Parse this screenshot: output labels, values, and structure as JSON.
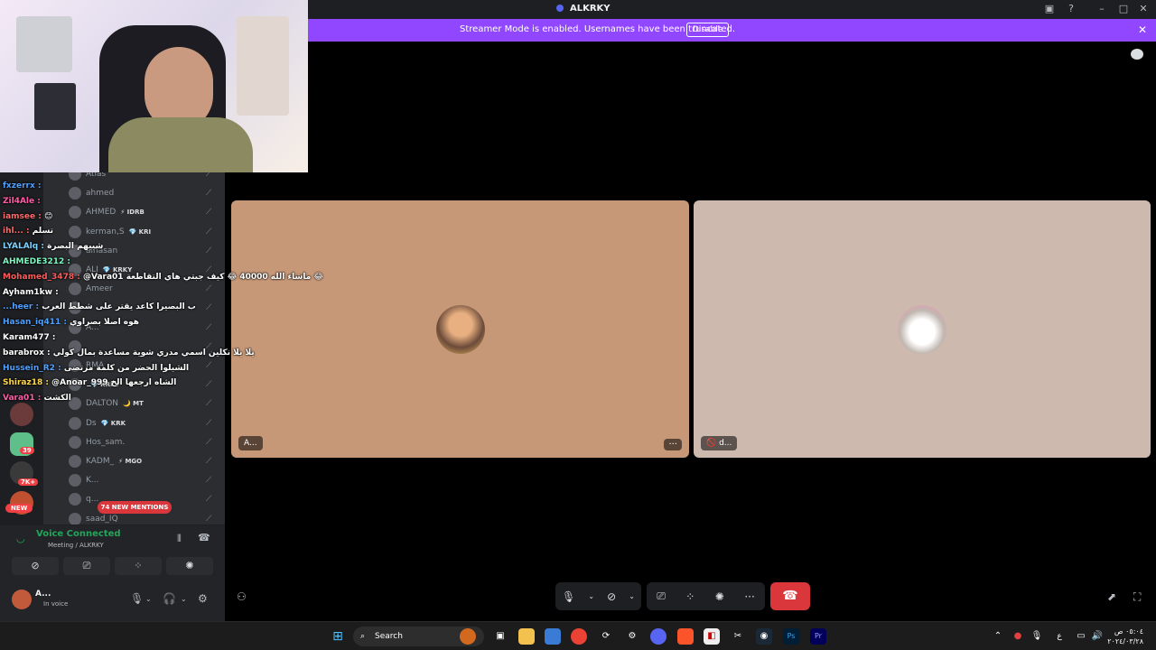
{
  "window": {
    "title": "ALKRKY"
  },
  "banner": {
    "text": "Streamer Mode is enabled. Usernames have been truncated.",
    "disable_label": "Disable"
  },
  "members": [
    {
      "name": "Atlas",
      "tag": ""
    },
    {
      "name": "ahmed",
      "tag": ""
    },
    {
      "name": "AHMED",
      "tag": "⚡ IDRB"
    },
    {
      "name": "kerman,S",
      "tag": "💎 KRI"
    },
    {
      "name": "alhasan",
      "tag": ""
    },
    {
      "name": "ALI",
      "tag": "💎 KRKY"
    },
    {
      "name": "Ameer",
      "tag": ""
    },
    {
      "name": "",
      "tag": ""
    },
    {
      "name": "A...",
      "tag": ""
    },
    {
      "name": "",
      "tag": ""
    },
    {
      "name": "RMA",
      "tag": ""
    },
    {
      "name": "",
      "tag": "💎 KRKY"
    },
    {
      "name": "DALTON",
      "tag": "🌙 MT"
    },
    {
      "name": "Ds",
      "tag": "💎 KRK"
    },
    {
      "name": "Hos_sam.",
      "tag": ""
    },
    {
      "name": "KADM_",
      "tag": "⚡ MGO"
    },
    {
      "name": "K...",
      "tag": ""
    },
    {
      "name": "q...",
      "tag": ""
    },
    {
      "name": "saad_IQ",
      "tag": ""
    }
  ],
  "chat": [
    {
      "user": "fxzerrx :",
      "msg": "",
      "color": "#4fa0ff"
    },
    {
      "user": "Zil4Ale :",
      "msg": "",
      "color": "#ff5ca8"
    },
    {
      "user": "iamsee :",
      "msg": "😊",
      "color": "#ff6b6b"
    },
    {
      "user": "ihl... :",
      "msg": "تسلم",
      "color": "#ff6b6b"
    },
    {
      "user": "LYALAlq :",
      "msg": "شبيهم البصرة",
      "color": "#7dd3fc"
    },
    {
      "user": "AHMEDE3212 :",
      "msg": "",
      "color": "#7cf7c0"
    },
    {
      "user": "Mohamed_3478 :",
      "msg": "@Vara01 ماشاء الله 40000 😂 كيف جبتي هاي التقاطعة 😂",
      "color": "#ff5c5c"
    },
    {
      "user": "Ayham1kw :",
      "msg": "",
      "color": "#ffffff"
    },
    {
      "user": "...heer :",
      "msg": "ب البصيرا كاعد يقتر على شطط العرب",
      "color": "#4fa0ff"
    },
    {
      "user": "Hasan_iq411 :",
      "msg": "هوه اصلا بصراوي",
      "color": "#4fa0ff"
    },
    {
      "user": "Karam477 :",
      "msg": "",
      "color": "#ffffff"
    },
    {
      "user": "barabrox :",
      "msg": "يلا يلا تكلين اسمي مدري شوية مساعدة بمال كولي",
      "color": "#ffffff"
    },
    {
      "user": "Hussein_R2 :",
      "msg": "الشيلوا الحضر من كلمة مرتضى",
      "color": "#4fa0ff"
    },
    {
      "user": "Shiraz18 :",
      "msg": "@Anoar_999 الشاه ارجعها الخ",
      "color": "#ffd84d"
    },
    {
      "user": "Vara01 :",
      "msg": "الكشت",
      "color": "#ff5ca8"
    }
  ],
  "guild_badges": {
    "a": "39",
    "b": "7K+",
    "c": "NEW"
  },
  "mentions_label": "74 NEW MENTIONS",
  "voice": {
    "status": "Voice Connected",
    "channel": "Meeting / ALKRKY"
  },
  "user": {
    "name": "A...",
    "status": "In voice"
  },
  "tiles": [
    {
      "label": "A...",
      "bg": "#c79878"
    },
    {
      "label": "d...",
      "bg": "#cdb9ad"
    }
  ],
  "taskbar": {
    "search_label": "Search",
    "time": "٠٥:٠٤ ص",
    "date": "٢٠٢٤/٠٣/٢٨"
  },
  "colors": {
    "accent": "#9146ff",
    "connected": "#23a55a",
    "danger": "#da373c"
  }
}
